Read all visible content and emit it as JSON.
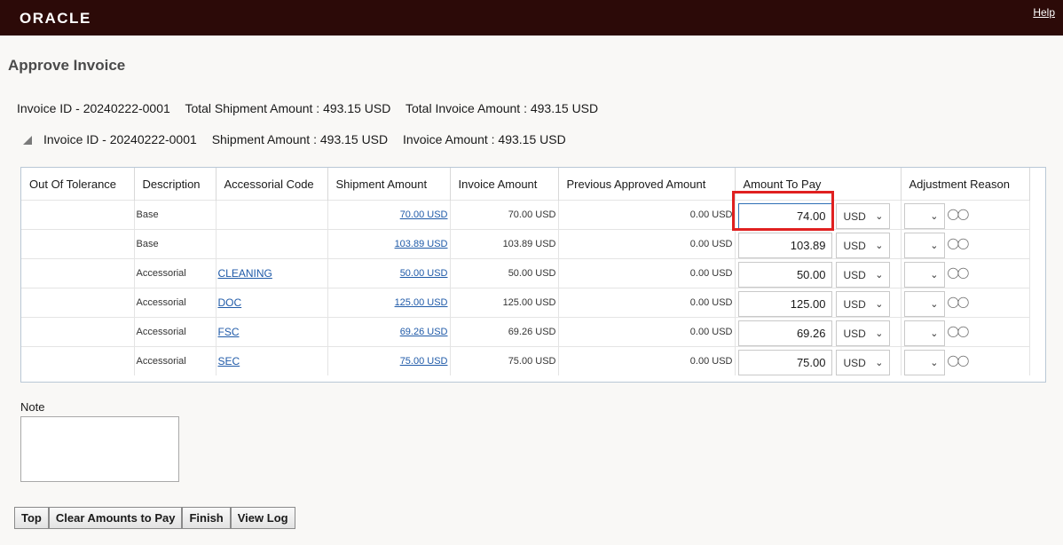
{
  "header": {
    "logo": "ORACLE",
    "help": "Help"
  },
  "page_title": "Approve Invoice",
  "summary": {
    "invoice_id": "Invoice ID - 20240222-0001",
    "total_shipment": "Total Shipment Amount : 493.15 USD",
    "total_invoice": "Total Invoice Amount : 493.15 USD"
  },
  "sub_summary": {
    "invoice_id": "Invoice ID - 20240222-0001",
    "shipment": "Shipment Amount : 493.15 USD",
    "invoice": "Invoice Amount : 493.15 USD"
  },
  "columns": [
    "Out Of Tolerance",
    "Description",
    "Accessorial Code",
    "Shipment Amount",
    "Invoice Amount",
    "Previous Approved Amount",
    "Amount To Pay",
    "Adjustment Reason"
  ],
  "rows": [
    {
      "tolerance": "",
      "description": "Base",
      "code": "",
      "shipment": "70.00 USD",
      "invoice": "70.00 USD",
      "previous": "0.00 USD",
      "pay": "74.00",
      "currency": "USD"
    },
    {
      "tolerance": "",
      "description": "Base",
      "code": "",
      "shipment": "103.89 USD",
      "invoice": "103.89 USD",
      "previous": "0.00 USD",
      "pay": "103.89",
      "currency": "USD"
    },
    {
      "tolerance": "",
      "description": "Accessorial",
      "code": "CLEANING",
      "shipment": "50.00 USD",
      "invoice": "50.00 USD",
      "previous": "0.00 USD",
      "pay": "50.00",
      "currency": "USD"
    },
    {
      "tolerance": "",
      "description": "Accessorial",
      "code": "DOC",
      "shipment": "125.00 USD",
      "invoice": "125.00 USD",
      "previous": "0.00 USD",
      "pay": "125.00",
      "currency": "USD"
    },
    {
      "tolerance": "",
      "description": "Accessorial",
      "code": "FSC",
      "shipment": "69.26 USD",
      "invoice": "69.26 USD",
      "previous": "0.00 USD",
      "pay": "69.26",
      "currency": "USD"
    },
    {
      "tolerance": "",
      "description": "Accessorial",
      "code": "SEC",
      "shipment": "75.00 USD",
      "invoice": "75.00 USD",
      "previous": "0.00 USD",
      "pay": "75.00",
      "currency": "USD"
    }
  ],
  "note": {
    "label": "Note",
    "value": ""
  },
  "buttons": {
    "top": "Top",
    "clear": "Clear Amounts to Pay",
    "finish": "Finish",
    "view_log": "View Log"
  },
  "icons": {
    "chevron": "chevron-down-icon",
    "glasses": "glasses-icon",
    "collapse": "collapse-triangle-icon"
  }
}
